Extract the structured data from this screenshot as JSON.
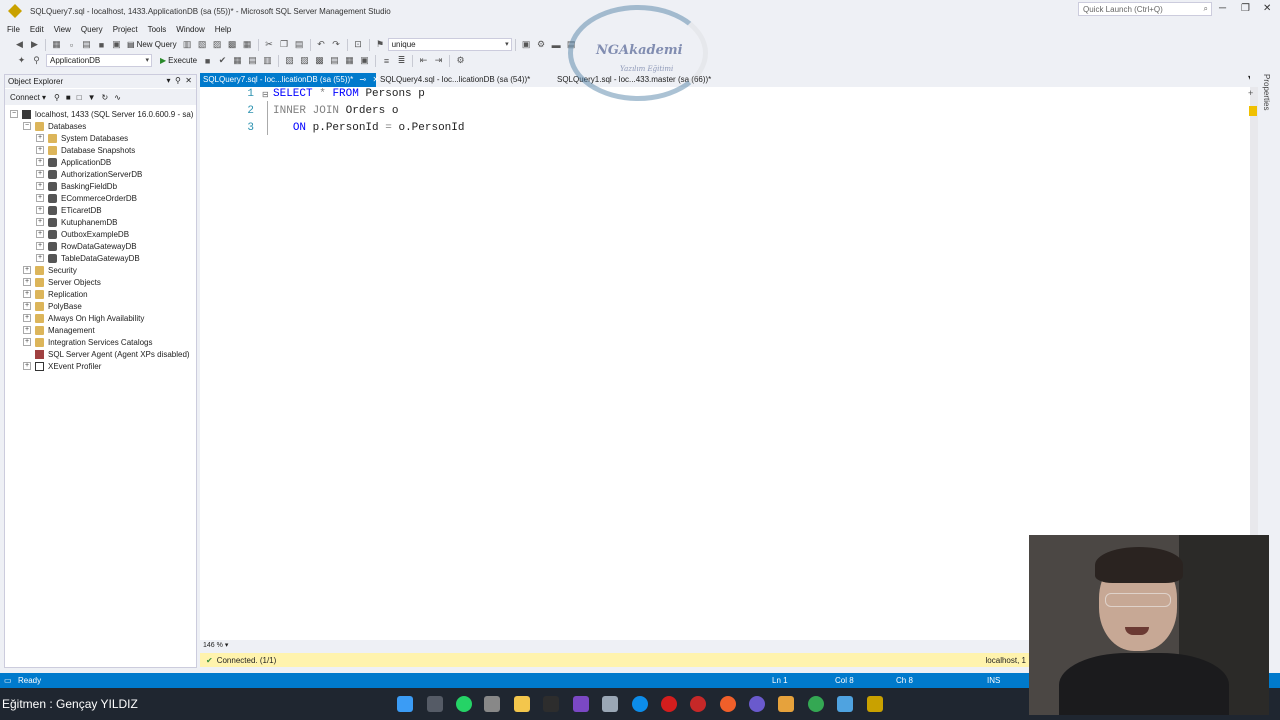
{
  "window": {
    "title": "SQLQuery7.sql - localhost, 1433.ApplicationDB (sa (55))* - Microsoft SQL Server Management Studio",
    "quick_launch_placeholder": "Quick Launch (Ctrl+Q)"
  },
  "menu": [
    "File",
    "Edit",
    "View",
    "Query",
    "Project",
    "Tools",
    "Window",
    "Help"
  ],
  "toolbar": {
    "new_query_label": "New Query",
    "find_combo_value": "unique",
    "database_combo_value": "ApplicationDB",
    "execute_label": "Execute"
  },
  "object_explorer": {
    "title": "Object Explorer",
    "connect_label": "Connect",
    "server_node": "localhost, 1433 (SQL Server 16.0.600.9 - sa)",
    "databases_label": "Databases",
    "databases": [
      "System Databases",
      "Database Snapshots",
      "ApplicationDB",
      "AuthorizationServerDB",
      "BaskingFieldDb",
      "ECommerceOrderDB",
      "ETicaretDB",
      "KutuphanemDB",
      "OutboxExampleDB",
      "RowDataGatewayDB",
      "TableDataGatewayDB"
    ],
    "server_children": [
      "Security",
      "Server Objects",
      "Replication",
      "PolyBase",
      "Always On High Availability",
      "Management",
      "Integration Services Catalogs",
      "SQL Server Agent (Agent XPs disabled)",
      "XEvent Profiler"
    ]
  },
  "tabs": [
    {
      "label": "SQLQuery7.sql - loc...licationDB (sa (55))*",
      "active": true
    },
    {
      "label": "SQLQuery4.sql - loc...licationDB (sa (54))*",
      "active": false
    },
    {
      "label": "SQLQuery1.sql - loc...433.master (sa (66))*",
      "active": false
    }
  ],
  "editor": {
    "line_numbers": [
      "1",
      "2",
      "3"
    ],
    "lines": [
      {
        "k1": "SELECT",
        "star": "*",
        "k2": "FROM",
        "rest": "Persons p"
      },
      {
        "k1": "INNER",
        "k2": "JOIN",
        "rest": "Orders o"
      },
      {
        "k1": "ON",
        "rest1": "p.PersonId",
        "eq": "=",
        "rest2": "o.PersonId"
      }
    ],
    "zoom": "146 %",
    "properties_label": "Properties"
  },
  "infobar": {
    "status": "Connected. (1/1)",
    "server": "localhost, 1"
  },
  "statusbar": {
    "ready": "Ready",
    "ln": "Ln 1",
    "col": "Col 8",
    "ch": "Ch 8",
    "ins": "INS"
  },
  "watermark": {
    "brand": "NGAkademi",
    "sub": "Yazılım Eğitimi"
  },
  "taskbar": {
    "instructor": "Eğitmen : Gençay YILDIZ"
  },
  "colors": {
    "accent": "#007acc",
    "infobar": "#fff3ad",
    "keyword": "#0000ff",
    "line_number": "#2b91af"
  }
}
